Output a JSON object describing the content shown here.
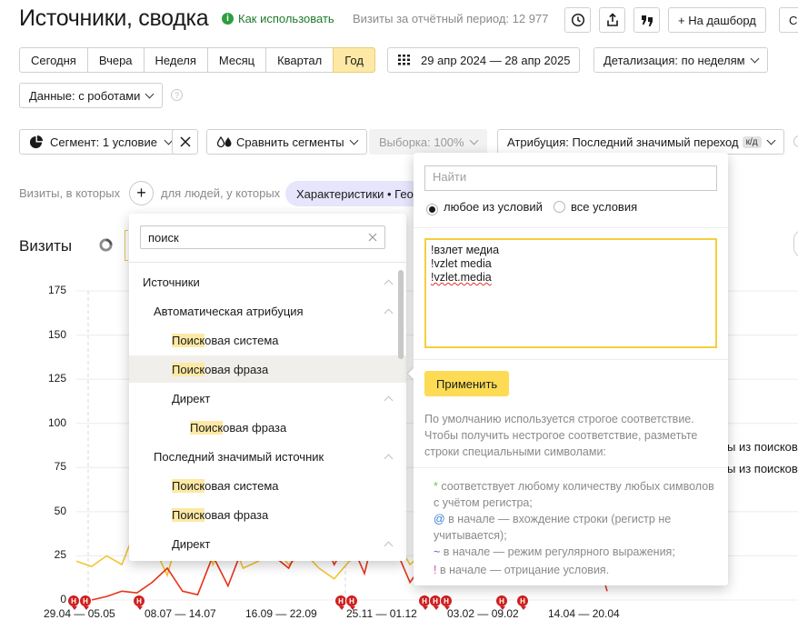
{
  "header": {
    "title": "Источники, сводка",
    "help_link": "Как использовать",
    "visits_period": "Визиты за отчётный период: 12 977",
    "dashboard_button": "+ На дашборд",
    "cut_button": "С"
  },
  "period": {
    "tabs": [
      "Сегодня",
      "Вчера",
      "Неделя",
      "Месяц",
      "Квартал",
      "Год"
    ],
    "active": "Год",
    "date_range": "29 апр 2024 — 28 апр 2025",
    "detail": "Детализация: по неделям"
  },
  "data_filter": {
    "label": "Данные: с роботами"
  },
  "filters": {
    "segment": "Сегмент: 1 условие",
    "compare": "Сравнить сегменты",
    "sample": "Выборка: 100%",
    "attribution": "Атрибуция: Последний значимый переход",
    "attribution_badge": "к/д"
  },
  "segment_builder": {
    "visits_label": "Визиты, в которых",
    "people_label": "для людей, у которых",
    "chip": "Характеристики • Гео"
  },
  "chart_section": {
    "title": "Визиты"
  },
  "dropdown": {
    "search_value": "поиск",
    "items": [
      {
        "text": "Источники",
        "level": 0,
        "chevron": true
      },
      {
        "text": "Автоматическая атрибуция",
        "level": 1,
        "chevron": true
      },
      {
        "highlight": "Поиск",
        "rest": "овая система",
        "level": 2,
        "chevron": false
      },
      {
        "highlight": "Поиск",
        "rest": "овая фраза",
        "level": 2,
        "chevron": false,
        "hovered": true
      },
      {
        "text": "Директ",
        "level": 2,
        "chevron": true
      },
      {
        "highlight": "Поиск",
        "rest": "овая фраза",
        "level": 3,
        "chevron": false
      },
      {
        "text": "Последний значимый источник",
        "level": 1,
        "chevron": true
      },
      {
        "highlight": "Поиск",
        "rest": "овая система",
        "level": 2,
        "chevron": false
      },
      {
        "highlight": "Поиск",
        "rest": "овая фраза",
        "level": 2,
        "chevron": false
      },
      {
        "text": "Директ",
        "level": 2,
        "chevron": true
      }
    ]
  },
  "condition_panel": {
    "search_placeholder": "Найти",
    "radio_any": "любое из условий",
    "radio_all": "все условия",
    "radio_selected": "any",
    "textarea_lines": [
      "!взлет медиа",
      "!vzlet media",
      "!vzlet.media"
    ],
    "apply_button": "Применить",
    "help_text": "По умолчанию используется строгое соответствие. Чтобы получить нестрогое соответствие, разметьте строки специальными символами:",
    "rules": [
      {
        "symbol": "*",
        "text": " соответствует любому количеству любых символов с учётом регистра;"
      },
      {
        "symbol": "@",
        "text": " в начале — вхождение строки (регистр не учитывается);"
      },
      {
        "symbol": "~",
        "text": " в начале — режим регулярного выражения;"
      },
      {
        "symbol": "!",
        "text": " в начале — отрицание условия."
      }
    ]
  },
  "legend_fragments": [
    "ы из поисков",
    "ы из поисков"
  ],
  "annotation_marker": "Н",
  "chart_data": {
    "type": "line",
    "y_ticks": [
      "175",
      "150",
      "125",
      "100",
      "75",
      "50",
      "25",
      "0"
    ],
    "ylim": [
      0,
      175
    ],
    "x_labels": [
      "29.04 — 05.05",
      "08.07 — 14.07",
      "16.09 — 22.09",
      "25.11 — 01.12",
      "03.02 — 09.02",
      "14.04 — 20.04"
    ],
    "series": [
      {
        "color": "#f4c430",
        "values": [
          22,
          19,
          25,
          20,
          42,
          32,
          14,
          45,
          60,
          20,
          40,
          18,
          22,
          30,
          20,
          27,
          18,
          12,
          22,
          26,
          30,
          35,
          20,
          28,
          35,
          25,
          30,
          22,
          38,
          30,
          42,
          25,
          30,
          45,
          35,
          30
        ]
      },
      {
        "color": "#e8321a",
        "values": [
          0,
          0,
          2,
          5,
          4,
          10,
          18,
          5,
          3,
          25,
          8,
          30,
          45,
          25,
          18,
          35,
          40,
          20,
          35,
          15,
          50,
          30,
          10,
          22,
          38,
          25,
          50,
          20,
          12,
          18,
          40,
          52,
          20,
          18,
          35,
          5
        ]
      }
    ]
  }
}
